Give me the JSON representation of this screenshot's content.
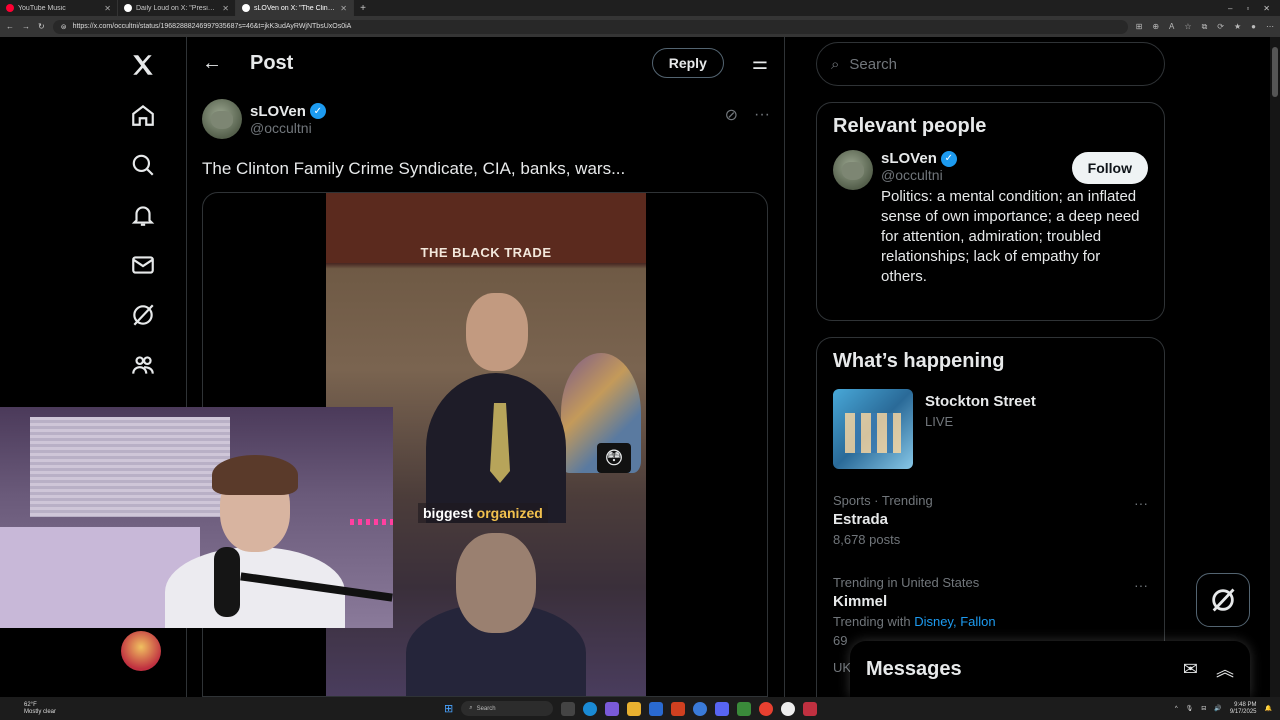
{
  "browser": {
    "tabs": [
      {
        "label": "YouTube Music",
        "color": "#ff0033"
      },
      {
        "label": "Daily Loud on X: \"President Trump",
        "color": "#ffffff"
      },
      {
        "label": "sLOVen on X: \"The Clinton Family",
        "color": "#ffffff",
        "active": true
      }
    ],
    "new_tab": "+",
    "url": "https://x.com/occultni/status/19682888246997935687s=46&t=jkK3udAyRWjNTbsUxOs0iA",
    "win_min": "–",
    "win_max": "▫",
    "win_close": "✕"
  },
  "header": {
    "title": "Post",
    "reply_label": "Reply"
  },
  "post": {
    "author_name": "sLOVen",
    "author_handle": "@occultni",
    "verified_mark": "✓",
    "text": "The Clinton Family Crime Syndicate, CIA, banks, wars...",
    "video_label": "THE BLACK TRADE",
    "caption_a": "biggest",
    "caption_b": "organized",
    "emoji": "😳",
    "more": "···"
  },
  "search": {
    "placeholder": "Search"
  },
  "relevant": {
    "title": "Relevant people",
    "name": "sLOVen",
    "handle": "@occultni",
    "follow_label": "Follow",
    "bio": "Politics: a mental condition; an inflated sense of own importance; a deep need for attention, admiration; troubled relationships; lack of empathy for others."
  },
  "happening": {
    "title": "What’s happening",
    "live": {
      "title": "Stockton Street",
      "sub": "LIVE"
    },
    "trends": [
      {
        "meta": "Sports · Trending",
        "name": "Estrada",
        "count": "8,678 posts"
      },
      {
        "meta": "Trending in United States",
        "name": "Kimmel",
        "with_label": "Trending with",
        "with_a": "Disney",
        "sep": ",",
        "with_b": "Fallon",
        "count": "69"
      }
    ],
    "more": "···",
    "cut_label": "UK"
  },
  "messages": {
    "title": "Messages"
  },
  "taskbar": {
    "temp": "62°F",
    "weather": "Mostly clear",
    "search": "Search",
    "time": "9:48 PM",
    "date": "9/17/2025"
  },
  "colors": {
    "accent": "#1d9bf0",
    "border": "#2f3336",
    "muted": "#71767b"
  }
}
